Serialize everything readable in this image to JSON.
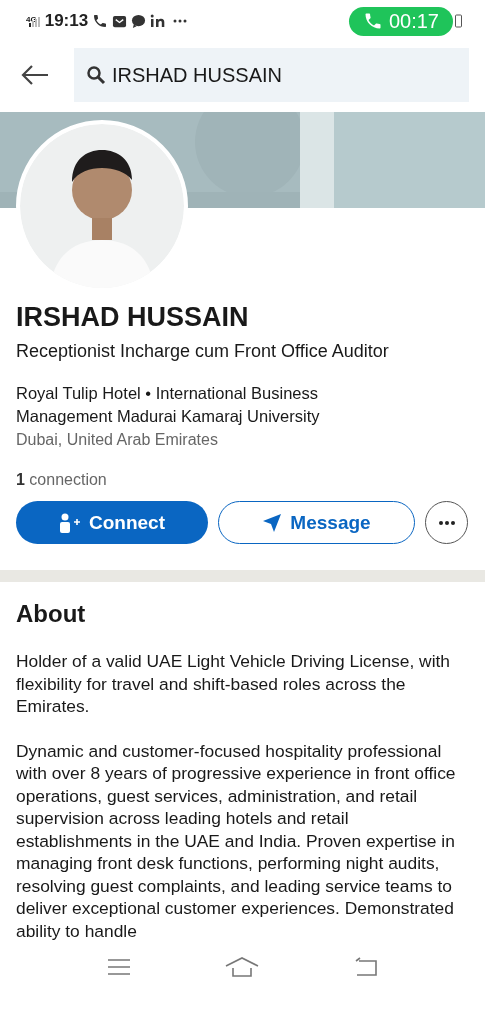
{
  "status_bar": {
    "network": "4G",
    "time": "19:13",
    "call_timer": "00:17"
  },
  "search": {
    "value": "IRSHAD HUSSAIN"
  },
  "profile": {
    "name": "IRSHAD HUSSAIN",
    "headline": "Receptionist Incharge cum Front Office Auditor",
    "education": "Royal Tulip Hotel • International Business Management Madurai Kamaraj University",
    "location": "Dubai, United Arab Emirates",
    "connections": "**1** connection"
  },
  "actions": [
    {
      "kind": "primary",
      "label": "Connect"
    },
    {
      "kind": "secondary",
      "label": "Message"
    },
    {
      "kind": "more"
    }
  ],
  "about": {
    "title": "About",
    "paragraphs": [
      "Holder of a valid UAE Light Vehicle Driving License, with flexibility for travel and shift-based roles across the Emirates.",
      "Dynamic and customer-focused hospitality professional with over 8 years of progressive experience in front office operations, guest services, administration, and retail supervision across leading hotels and retail establishments in the UAE and India. Proven expertise in managing front desk functions, performing night audits, resolving guest complaints, and leading service teams to deliver exceptional customer experiences. Demonstrated ability to handle"
    ]
  }
}
